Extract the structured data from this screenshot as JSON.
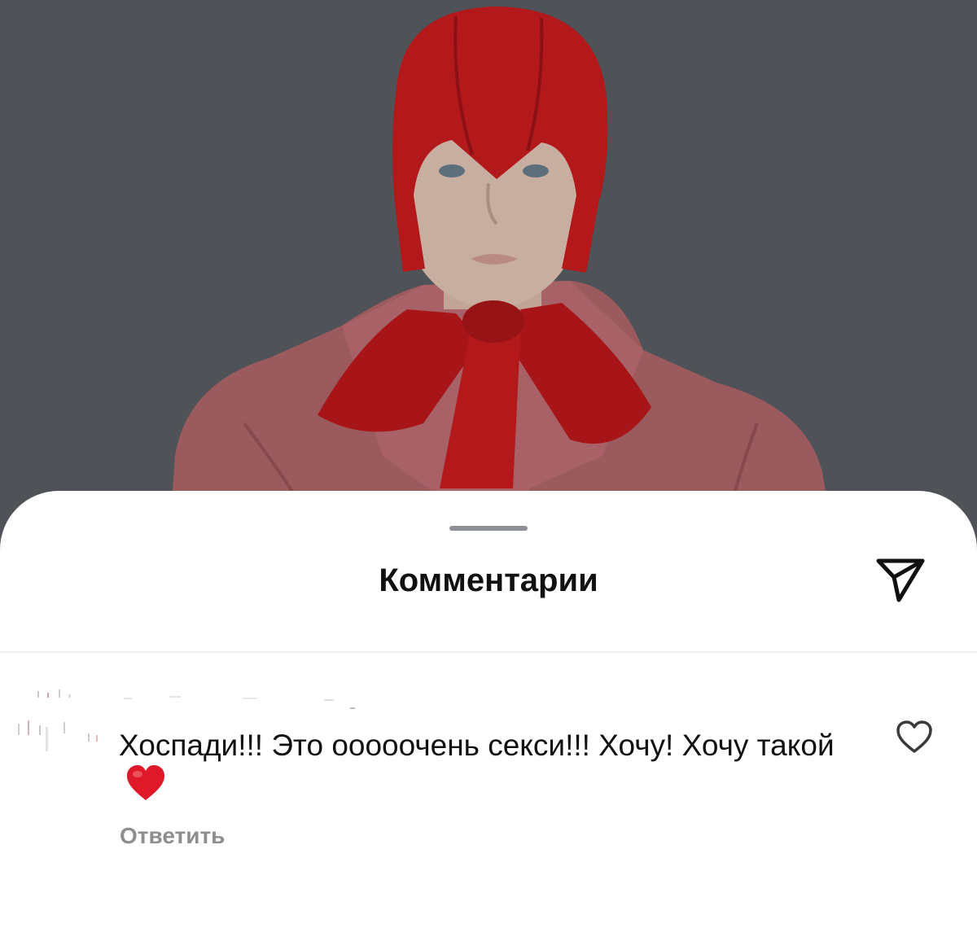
{
  "sheet": {
    "title": "Комментарии",
    "share_icon": "send-icon"
  },
  "comment": {
    "text": "Хоспади!!! Это ооооочень секси!!! Хочу! Хочу такой",
    "emoji": "❤️",
    "reply_label": "Ответить",
    "like_icon": "heart-outline-icon"
  },
  "colors": {
    "photo_dim": "#4b4e53",
    "hat_red": "#b3181b",
    "coat_pink": "#b06468",
    "text_primary": "#111111",
    "text_secondary": "#8e8e8e",
    "emoji_red": "#e0192a"
  }
}
